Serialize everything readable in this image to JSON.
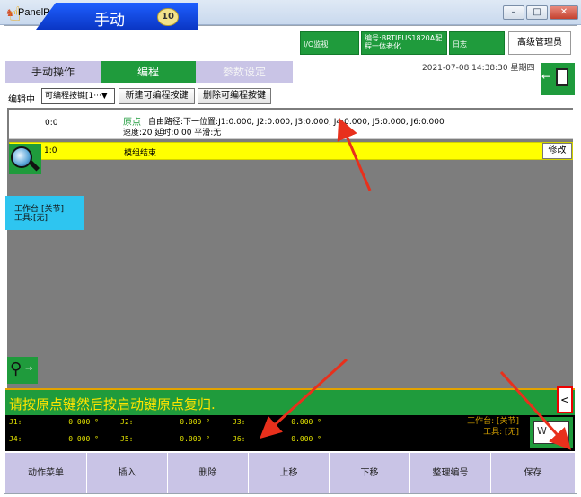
{
  "window": {
    "title": "PanelRobot",
    "app_icon": "robot-app-icon",
    "minimize_label": "–",
    "maximize_label": "□",
    "close_label": "✕"
  },
  "header": {
    "mode_label": "手动",
    "speed_value": "10",
    "io_monitor_label": "I/O监视",
    "code_label": "编号:BRTIEUS1820A配程一体老化",
    "log_label": "日志",
    "user_label": "高级管理员",
    "datetime": "2021-07-08  14:38:30  星期四"
  },
  "tabs": [
    {
      "label": "手动操作"
    },
    {
      "label": "编程"
    },
    {
      "label": "参数设定"
    }
  ],
  "toolbar": {
    "edit_label": "编辑中",
    "key_select_value": "可编程按键[1···▼",
    "new_key_label": "新建可编程按键",
    "delete_key_label": "删除可编程按键"
  },
  "program": {
    "rows": [
      {
        "index": "0:0",
        "name": "原点",
        "line1": "自由路径:下一位置:J1:0.000, J2:0.000, J3:0.000, J4:0.000, J5:0.000, J6:0.000",
        "line2": "速度:20 延时:0.00 平滑:无"
      },
      {
        "index": "1:0",
        "text": "模组结束"
      }
    ],
    "modify_label": "修改"
  },
  "coord_panel": {
    "line1": "工作台:[关节]",
    "line2": "工具:[无]"
  },
  "status": {
    "message": "请按原点键然后按启动键原点复归.",
    "collapse_label": "<"
  },
  "joints": [
    {
      "label": "J1:",
      "value": "0.000 °"
    },
    {
      "label": "J2:",
      "value": "0.000 °"
    },
    {
      "label": "J3:",
      "value": "0.000 °"
    },
    {
      "label": "J4:",
      "value": "0.000 °"
    },
    {
      "label": "J5:",
      "value": "0.000 °"
    },
    {
      "label": "J6:",
      "value": "0.000 °"
    }
  ],
  "reference": {
    "workbench": "工作台: [关节]",
    "tool": "工具: [无]",
    "w_label": "W",
    "j_label": "J"
  },
  "functions": [
    {
      "label": "动作菜单"
    },
    {
      "label": "插入"
    },
    {
      "label": "删除"
    },
    {
      "label": "上移"
    },
    {
      "label": "下移"
    },
    {
      "label": "整理编号"
    },
    {
      "label": "保存"
    }
  ],
  "colors": {
    "accent_green": "#1f9b3c",
    "tab_lavender": "#c9c4e6",
    "highlight_yellow": "#ffff00",
    "annotation_red": "#e8301c"
  }
}
